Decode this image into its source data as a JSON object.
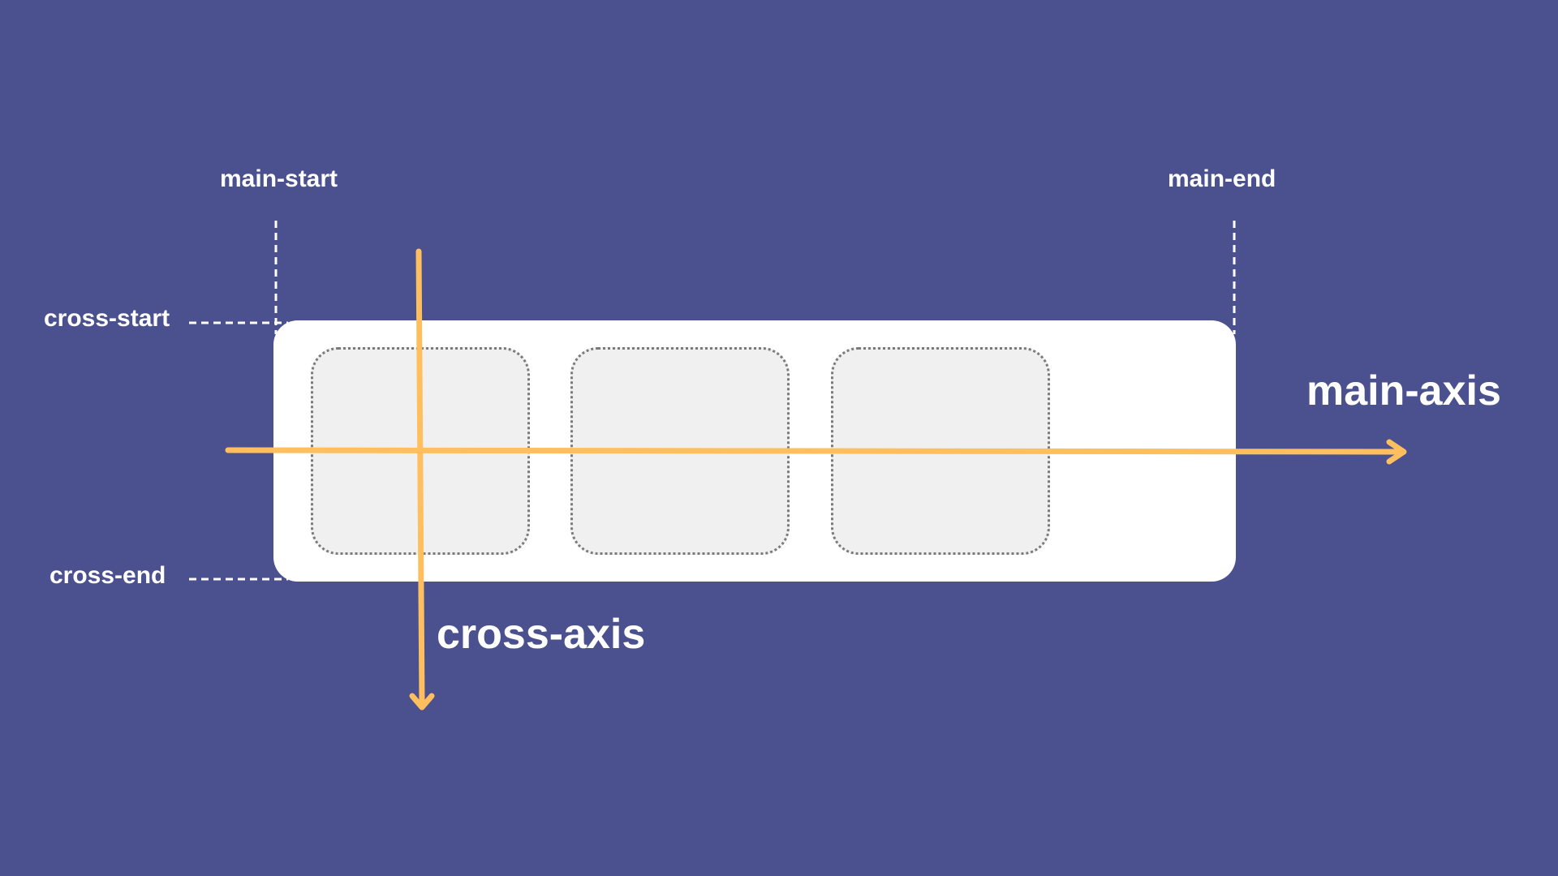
{
  "labels": {
    "main_start": "main-start",
    "main_end": "main-end",
    "cross_start": "cross-start",
    "cross_end": "cross-end",
    "main_axis": "main-axis",
    "cross_axis": "cross-axis"
  },
  "flex_items_count": 3,
  "colors": {
    "background": "#4b518f",
    "container": "#ffffff",
    "item_fill": "#f0f0f0",
    "item_border": "#7a7a7a",
    "axis": "#ffbf5e",
    "guide": "#ffffff"
  }
}
